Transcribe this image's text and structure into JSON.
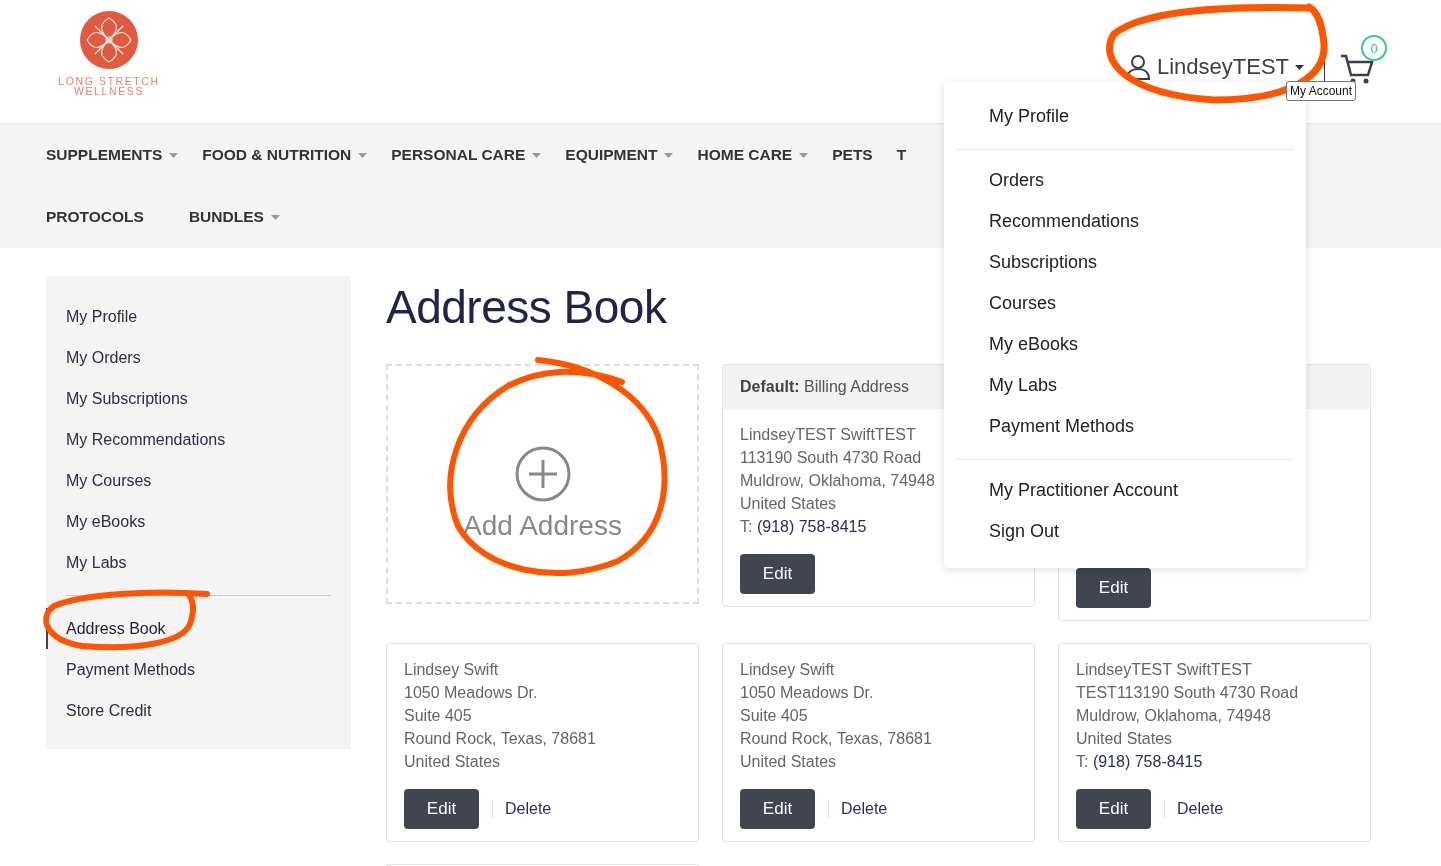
{
  "logo": {
    "line1": "LONG STRETCH",
    "line2": "WELLNESS"
  },
  "account": {
    "username": "LindseyTEST",
    "tooltip": "My Account"
  },
  "cart": {
    "count": "0"
  },
  "nav_rows": [
    [
      {
        "label": "SUPPLEMENTS",
        "has_menu": true
      },
      {
        "label": "FOOD & NUTRITION",
        "has_menu": true
      },
      {
        "label": "PERSONAL CARE",
        "has_menu": true
      },
      {
        "label": "EQUIPMENT",
        "has_menu": true
      },
      {
        "label": "HOME CARE",
        "has_menu": true
      },
      {
        "label": "PETS",
        "has_menu": false
      },
      {
        "label": "T"
      }
    ],
    [
      {
        "label": "PROTOCOLS",
        "has_menu": false
      },
      {
        "label": "BUNDLES",
        "has_menu": true
      }
    ]
  ],
  "sidebar": {
    "groups": [
      [
        {
          "label": "My Profile",
          "selected": false
        },
        {
          "label": "My Orders",
          "selected": false
        },
        {
          "label": "My Subscriptions",
          "selected": false
        },
        {
          "label": "My Recommendations",
          "selected": false
        },
        {
          "label": "My Courses",
          "selected": false
        },
        {
          "label": "My eBooks",
          "selected": false
        },
        {
          "label": "My Labs",
          "selected": false
        }
      ],
      [
        {
          "label": "Address Book",
          "selected": true
        },
        {
          "label": "Payment Methods",
          "selected": false
        },
        {
          "label": "Store Credit",
          "selected": false
        }
      ]
    ]
  },
  "page_title": "Address Book",
  "cards": [
    {
      "kind": "add",
      "label": "Add Address"
    },
    {
      "kind": "address",
      "header": "**Default:** Billing Address",
      "lines": [
        "LindseyTEST SwiftTEST",
        "113190 South 4730 Road",
        "Muldrow, Oklahoma, 74948",
        "United States"
      ],
      "phone_label": "T:",
      "phone": "(918) 758-8415",
      "edit": "Edit"
    },
    {
      "kind": "address",
      "header_hidden": true,
      "edit": "Edit"
    },
    {
      "kind": "address",
      "lines": [
        "Lindsey Swift",
        "1050 Meadows Dr.",
        "Suite 405",
        "Round Rock, Texas, 78681",
        "United States"
      ],
      "edit": "Edit",
      "delete": "Delete"
    },
    {
      "kind": "address",
      "lines": [
        "Lindsey Swift",
        "1050 Meadows Dr.",
        "Suite 405",
        "Round Rock, Texas, 78681",
        "United States"
      ],
      "edit": "Edit",
      "delete": "Delete"
    },
    {
      "kind": "address",
      "lines": [
        "LindseyTEST SwiftTEST",
        "TEST113190 South 4730 Road",
        "Muldrow, Oklahoma, 74948",
        "United States"
      ],
      "phone_label": "T:",
      "phone": "(918) 758-8415",
      "edit": "Edit",
      "delete": "Delete"
    },
    {
      "kind": "blank"
    }
  ],
  "account_menu": [
    [
      "My Profile"
    ],
    [
      "Orders",
      "Recommendations",
      "Subscriptions",
      "Courses",
      "My eBooks",
      "My Labs",
      "Payment Methods"
    ],
    [
      "My Practitioner Account",
      "Sign Out"
    ]
  ]
}
